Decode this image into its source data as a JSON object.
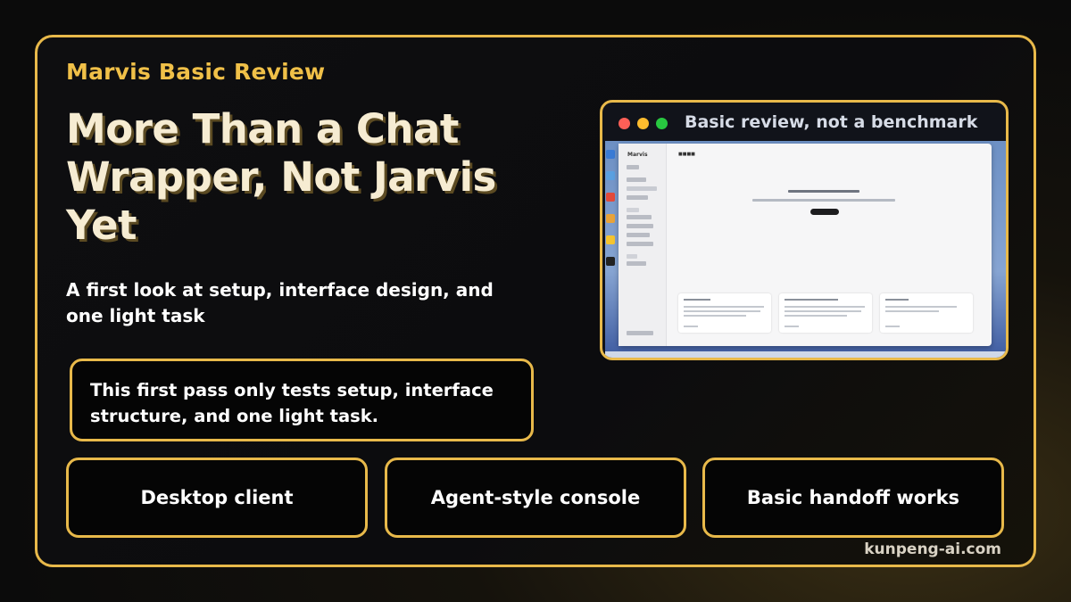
{
  "header": {
    "kicker": "Marvis Basic Review",
    "title": "More Than a Chat Wrapper, Not Jarvis Yet",
    "subtitle": "A first look at setup, interface design, and one light task"
  },
  "note": "This first pass only tests setup, interface structure, and one light task.",
  "features": [
    "Desktop client",
    "Agent-style console",
    "Basic handoff works"
  ],
  "screenshot": {
    "window_title": "Basic review, not a benchmark",
    "app_name": "Marvis"
  },
  "footer": "kunpeng-ai.com",
  "colors": {
    "accent": "#e8b94a",
    "kicker": "#f0c048",
    "title": "#f6ecd2",
    "traffic_close": "#ff5f57",
    "traffic_min": "#febc2e",
    "traffic_max": "#28c840"
  }
}
